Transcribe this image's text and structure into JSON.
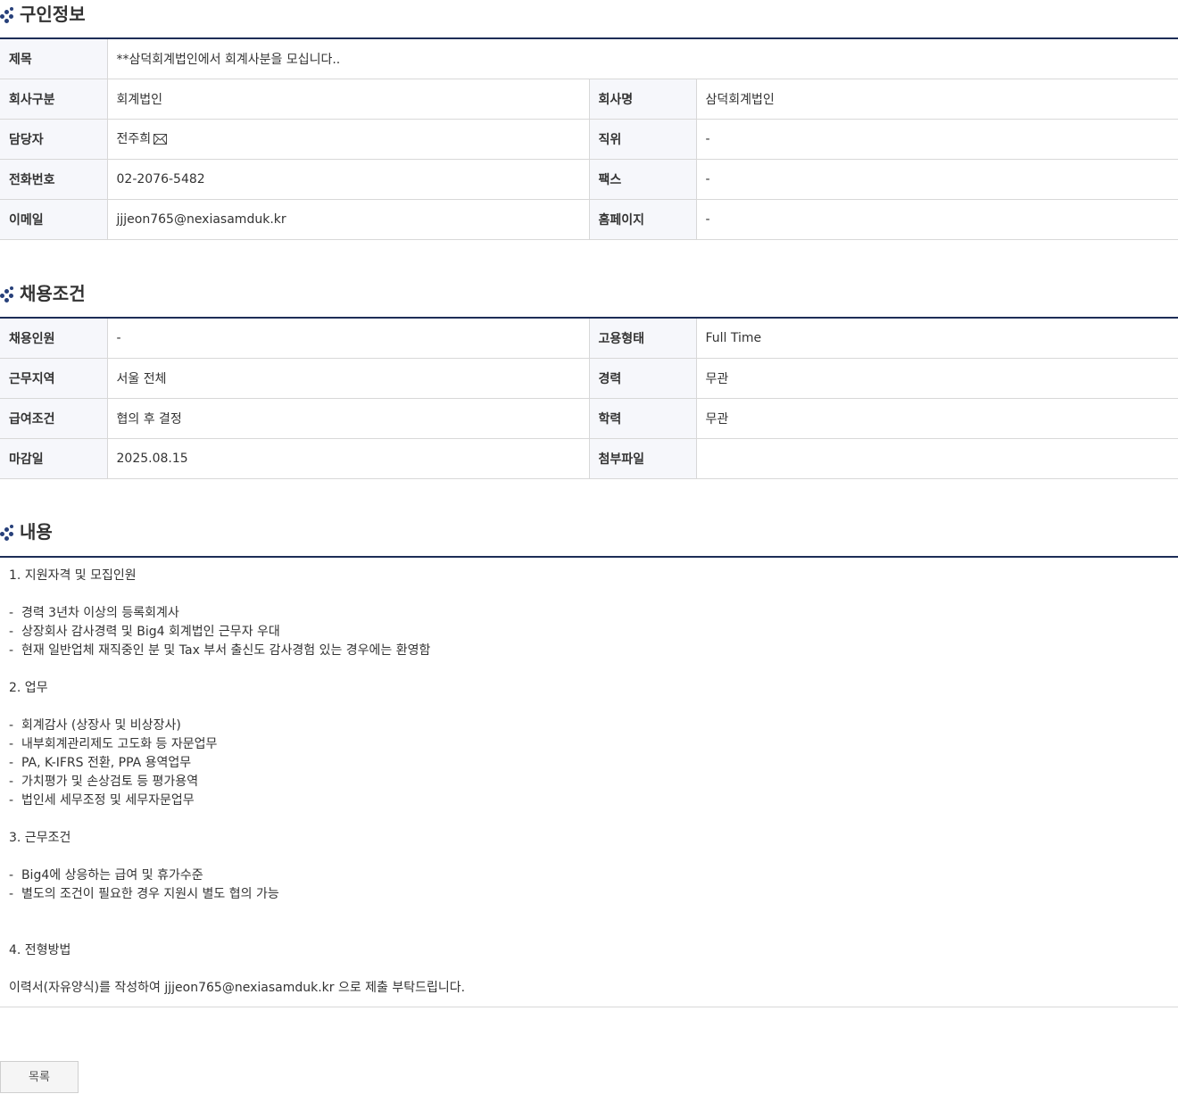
{
  "sections": {
    "job_info": "구인정보",
    "conditions": "채용조건",
    "content": "내용"
  },
  "job_info": {
    "title_label": "제목",
    "title_value": "**삼덕회계법인에서 회계사분을 모십니다..",
    "company_type_label": "회사구분",
    "company_type_value": "회계법인",
    "company_name_label": "회사명",
    "company_name_value": "삼덕회계법인",
    "manager_label": "담당자",
    "manager_value": "전주희",
    "position_label": "직위",
    "position_value": "-",
    "phone_label": "전화번호",
    "phone_value": "02-2076-5482",
    "fax_label": "팩스",
    "fax_value": "-",
    "email_label": "이메일",
    "email_value": "jjjeon765@nexiasamduk.kr",
    "homepage_label": "홈페이지",
    "homepage_value": "-"
  },
  "conditions": {
    "headcount_label": "채용인원",
    "headcount_value": "-",
    "employment_type_label": "고용형태",
    "employment_type_value": "Full Time",
    "location_label": "근무지역",
    "location_value": "서울 전체",
    "experience_label": "경력",
    "experience_value": "무관",
    "salary_label": "급여조건",
    "salary_value": "협의 후 결정",
    "education_label": "학력",
    "education_value": "무관",
    "deadline_label": "마감일",
    "deadline_value": "2025.08.15",
    "attachment_label": "첨부파일",
    "attachment_value": ""
  },
  "content_lines": [
    "1. 지원자격 및 모집인원",
    "",
    "-  경력 3년차 이상의 등록회계사",
    "-  상장회사 감사경력 및 Big4 회계법인 근무자 우대",
    "-  현재 일반업체 재직중인 분 및 Tax 부서 출신도 감사경험 있는 경우에는 환영함",
    "",
    "2. 업무",
    "",
    "-  회계감사 (상장사 및 비상장사)",
    "-  내부회계관리제도 고도화 등 자문업무",
    "-  PA, K-IFRS 전환, PPA 용역업무",
    "-  가치평가 및 손상검토 등 평가용역",
    "-  법인세 세무조정 및 세무자문업무",
    "",
    "3. 근무조건",
    "",
    "-  Big4에 상응하는 급여 및 휴가수준",
    "-  별도의 조건이 필요한 경우 지원시 별도 협의 가능",
    "",
    "",
    "4. 전형방법",
    "",
    "이력서(자유양식)를 작성하여 jjjeon765@nexiasamduk.kr 으로 제출 부탁드립니다."
  ],
  "buttons": {
    "list": "목록"
  }
}
